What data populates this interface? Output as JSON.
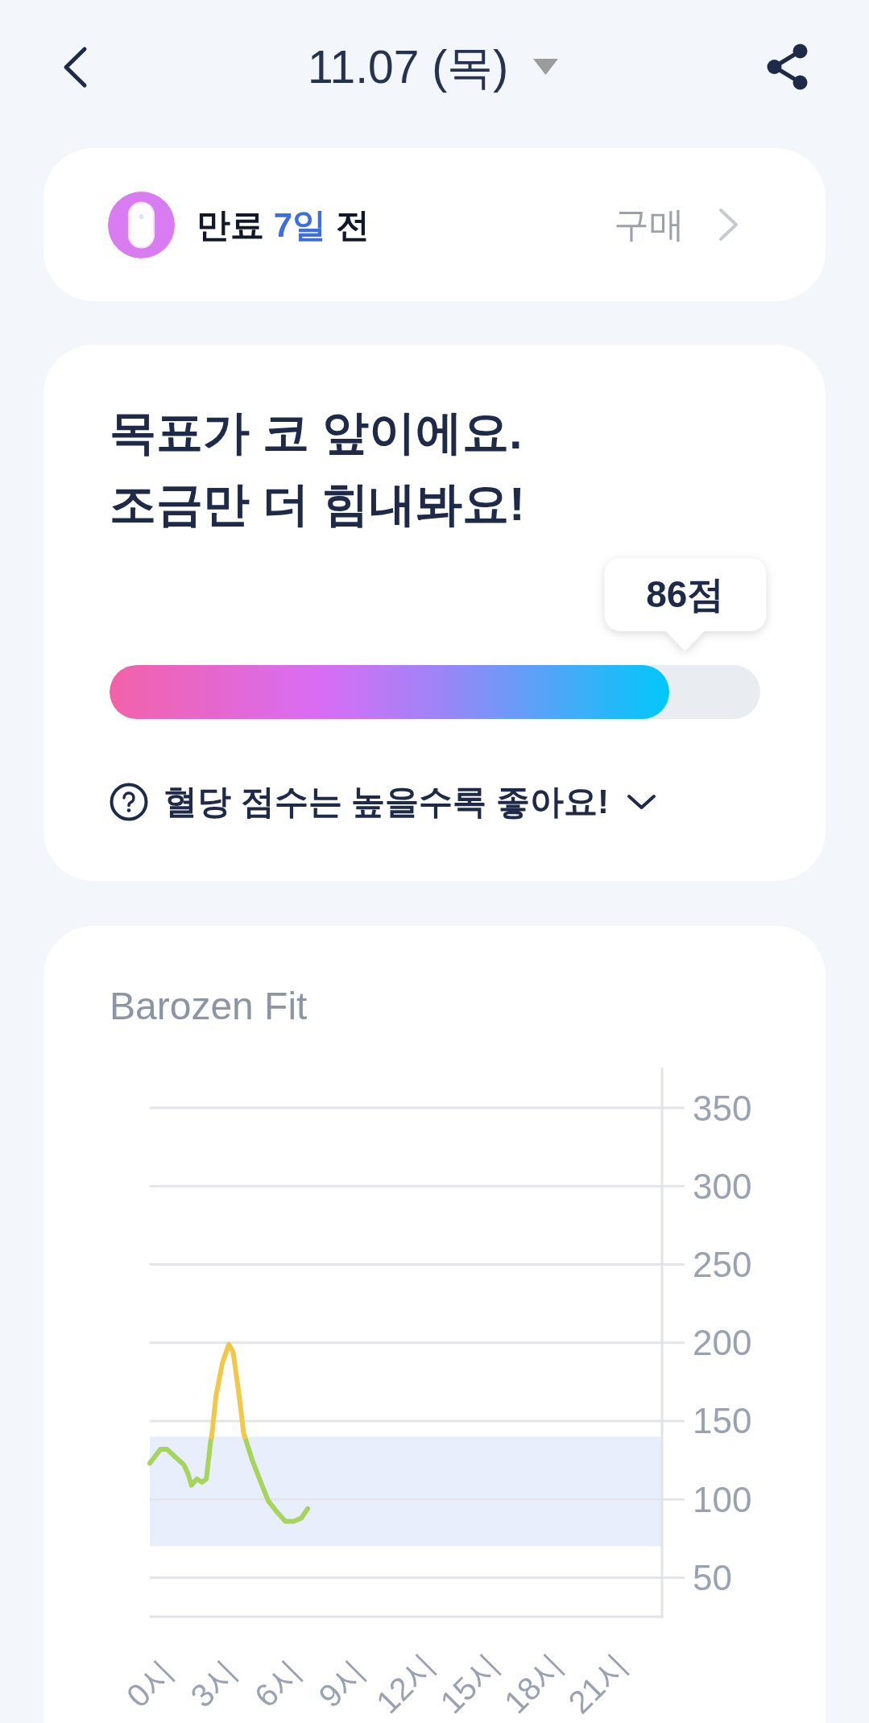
{
  "header": {
    "title": "11.07 (목)"
  },
  "subscription": {
    "expiry_before": "만료",
    "expiry_days": "7일",
    "expiry_after": "전",
    "buy_label": "구매"
  },
  "score_card": {
    "message": "목표가 코 앞이에요.\n조금만 더 힘내봐요!",
    "score": "86점",
    "level": 0.86,
    "hint": "혈당 점수는 높을수록 좋아요!",
    "hint_expanded": false
  },
  "chart_card": {
    "title": "Barozen Fit",
    "chart_data": {
      "type": "line",
      "x": [
        0,
        0.5,
        0.8,
        1.2,
        1.6,
        1.8,
        1.95,
        2.2,
        2.45,
        2.65,
        2.85,
        2.9,
        3.1,
        3.4,
        3.7,
        3.9,
        4.15,
        4.4,
        4.45,
        4.8,
        5.2,
        5.55,
        5.95,
        6.35,
        6.75,
        7.1,
        7.4
      ],
      "series": [
        {
          "color": "#a6d45c",
          "values": [
            123,
            132,
            132,
            127,
            122,
            116,
            109,
            113,
            111,
            113,
            137,
            140,
            null,
            null,
            null,
            null,
            null,
            null,
            140,
            125,
            111,
            99,
            92,
            86,
            86,
            88,
            94
          ]
        },
        {
          "color": "#f2c84b",
          "values": [
            null,
            null,
            null,
            null,
            null,
            null,
            null,
            null,
            null,
            null,
            null,
            140,
            166,
            187,
            199,
            194,
            170,
            142,
            140,
            null,
            null,
            null,
            null,
            null,
            null,
            null,
            null
          ]
        }
      ],
      "xlim": [
        0,
        24
      ],
      "ylim": [
        25,
        375
      ],
      "xticks": [
        {
          "value": 0,
          "label": "0시"
        },
        {
          "value": 3,
          "label": "3시"
        },
        {
          "value": 6,
          "label": "6시"
        },
        {
          "value": 9,
          "label": "9시"
        },
        {
          "value": 12,
          "label": "12시"
        },
        {
          "value": 15,
          "label": "15시"
        },
        {
          "value": 18,
          "label": "18시"
        },
        {
          "value": 21,
          "label": "21시"
        }
      ],
      "yticks": [
        50,
        100,
        150,
        200,
        250,
        300,
        350
      ],
      "grid": true,
      "bands": [
        {
          "axis": "y",
          "from": 70,
          "to": 140
        }
      ]
    }
  }
}
